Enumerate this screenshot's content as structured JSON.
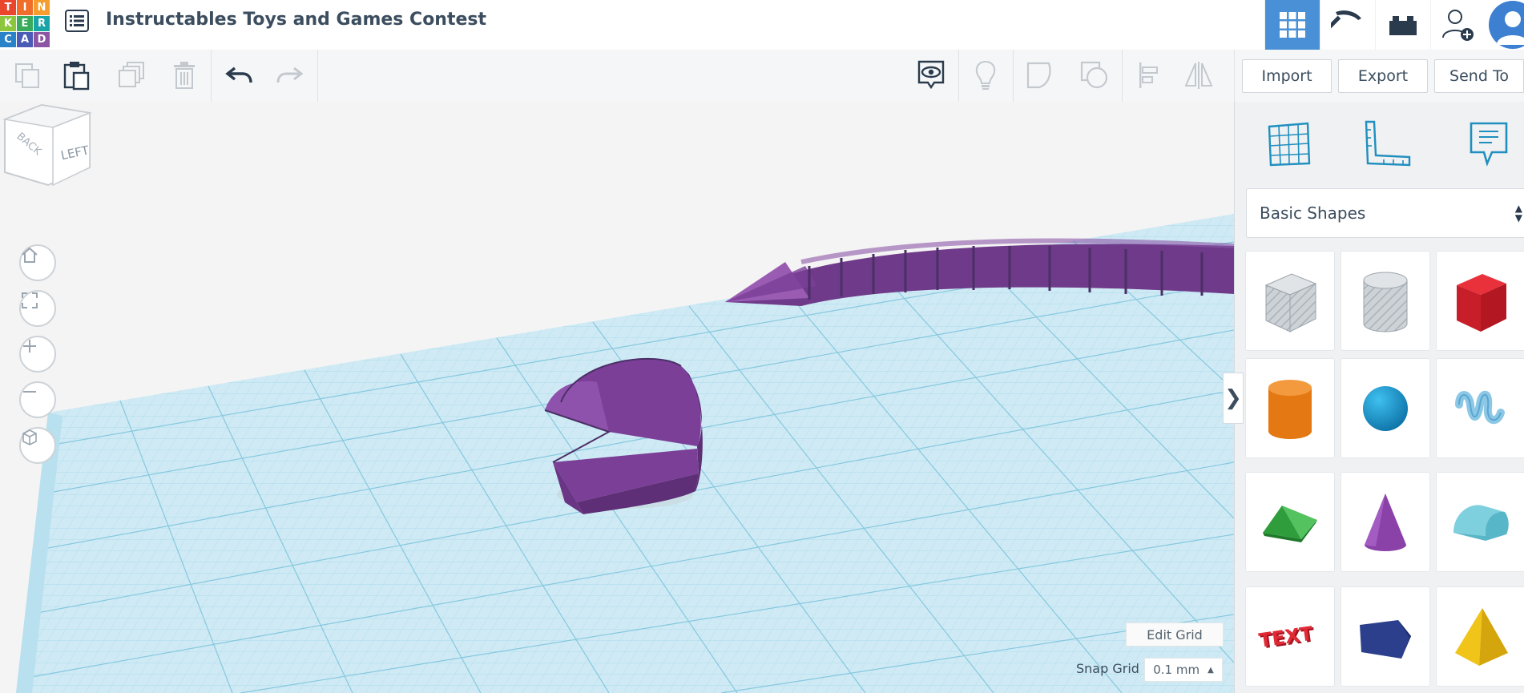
{
  "header": {
    "logo_letters": [
      "T",
      "I",
      "N",
      "K",
      "E",
      "R",
      "C",
      "A",
      "D"
    ],
    "logo_colors": [
      "#e9462d",
      "#f06e2a",
      "#f59e2d",
      "#8cc63f",
      "#3aab5a",
      "#19a5a8",
      "#2a82c9",
      "#4a5bb5",
      "#8c56a4"
    ],
    "title": "Instructables Toys and Games Contest",
    "right_icons": [
      "grid-view-icon",
      "pickaxe-icon",
      "bricks-icon",
      "add-user-icon",
      "profile-avatar-icon"
    ]
  },
  "toolbar": {
    "import_label": "Import",
    "export_label": "Export",
    "sendto_label": "Send To"
  },
  "viewport": {
    "navcube": {
      "face_left": "LEFT",
      "face_back": "BACK"
    },
    "edit_grid_label": "Edit Grid",
    "snap_grid_label": "Snap Grid",
    "snap_grid_value": "0.1 mm",
    "collapse_glyph": "❯"
  },
  "panel": {
    "shape_library": "Basic Shapes",
    "shapes": [
      "box-hole",
      "cylinder-hole",
      "box",
      "cylinder",
      "sphere",
      "scribble",
      "roof",
      "cone",
      "round-roof",
      "text",
      "polygon",
      "pyramid"
    ]
  },
  "colors": {
    "accent": "#4a90d6",
    "grid": "#8fd0e6",
    "shape_purple": "#7b3f97"
  }
}
